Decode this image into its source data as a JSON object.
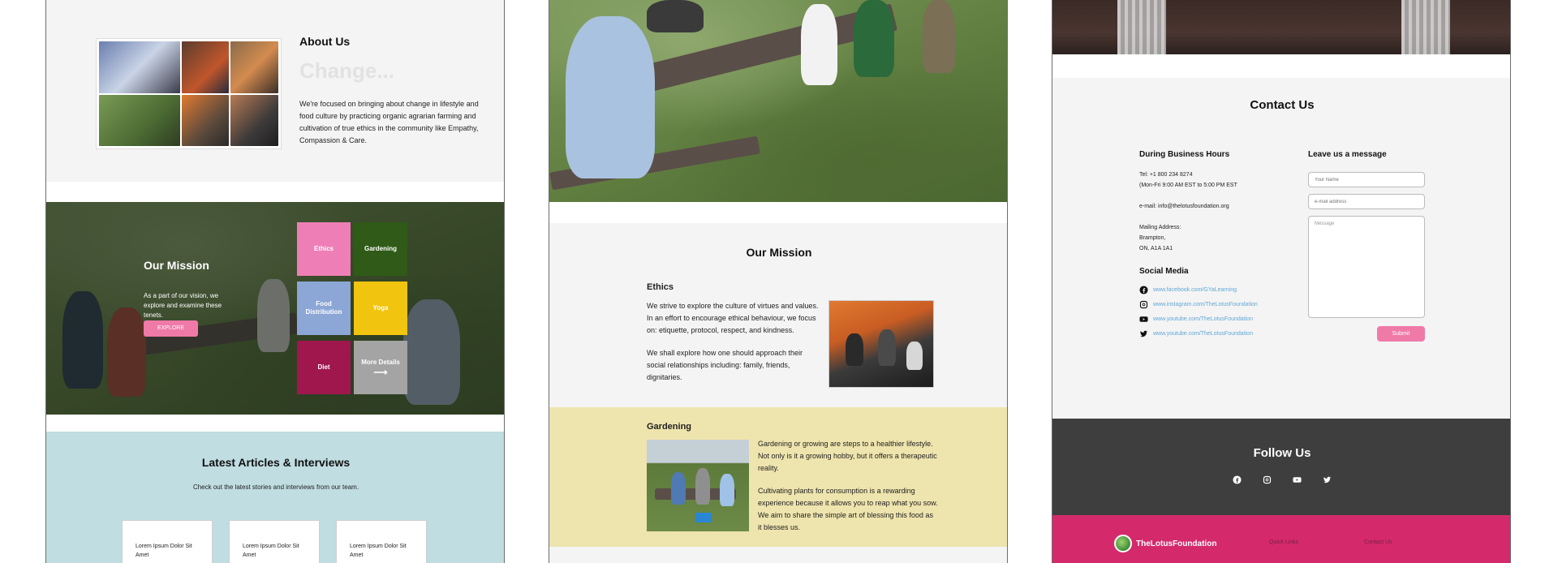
{
  "panel1": {
    "about": {
      "title": "About Us",
      "headline": "Change...",
      "text": "We're focused on bringing about change in lifestyle and food culture by practicing organic agrarian farming and cultivation of true ethics in the community like Empathy, Compassion & Care."
    },
    "mission": {
      "title": "Our Mission",
      "text": "As a part of our vision, we explore and examine these tenets.",
      "button": "EXPLORE",
      "tiles": [
        {
          "label": "Ethics",
          "color": "#ee7fb6"
        },
        {
          "label": "Gardening",
          "color": "#2f5a17"
        },
        {
          "label": "Food Distribution",
          "color": "#8ca6d6"
        },
        {
          "label": "Yoga",
          "color": "#f1c40f"
        },
        {
          "label": "Diet",
          "color": "#a0174d"
        },
        {
          "label": "More Details",
          "color": "#a4a4a4"
        }
      ]
    },
    "articles": {
      "title": "Latest Articles & Interviews",
      "subtitle": "Check out the latest stories and interviews from our team.",
      "cards": [
        "Lorem Ipsum Dolor Sit Amet",
        "Lorem Ipsum Dolor Sit Amet",
        "Lorem Ipsum Dolor Sit Amet"
      ]
    }
  },
  "panel2": {
    "mission_title": "Our Mission",
    "ethics": {
      "heading": "Ethics",
      "p1": "We strive to explore the culture of virtues and values. In an effort to encourage ethical behaviour, we focus on: etiquette, protocol, respect, and kindness.",
      "p2": "We shall explore how one should approach their social relationships including: family, friends, dignitaries."
    },
    "gardening": {
      "heading": "Gardening",
      "p1": "Gardening or growing are steps to a healthier lifestyle. Not only is it a growing hobby, but it offers a therapeutic reality.",
      "p2": "Cultivating plants for consumption is a rewarding experience because it allows you to reap what you sow. We aim to share the simple art of blessing this food as it blesses us."
    }
  },
  "panel3": {
    "contact_title": "Contact Us",
    "hours": {
      "heading": "During Business Hours",
      "tel": "Tel: +1 800 234 8274",
      "time": "(Mon-Fri 9:00 AM EST  to 5:00 PM EST",
      "email": "e-mail: info@thelotusfoundation.org",
      "mail_label": "Mailing Address:",
      "city": "Brampton,",
      "postal": "ON, A1A 1A1"
    },
    "social_heading": "Social Media",
    "social": [
      {
        "icon": "facebook-icon",
        "text": "www.facebook.com/GYaLearning"
      },
      {
        "icon": "instagram-icon",
        "text": "www.instagram.com/TheLotusFoundation"
      },
      {
        "icon": "youtube-icon",
        "text": "www.youtube.com/TheLotusFoundation"
      },
      {
        "icon": "twitter-icon",
        "text": "www.youtube.com/TheLotusFoundation"
      }
    ],
    "form": {
      "heading": "Leave us a message",
      "name_placeholder": "Your Name",
      "email_placeholder": "e-mail address",
      "message_placeholder": "Message",
      "submit": "Submit"
    },
    "follow": {
      "title": "Follow Us"
    },
    "footer": {
      "logo_text": "TheLotusFoundation",
      "quick_links": "Quick Links",
      "contact_us": "Contact Us"
    }
  },
  "colors": {
    "accent_pink": "#ef7aa8",
    "footer_pink": "#d42a6b",
    "dark": "#3e3e3e",
    "link_blue": "#5fa8d6"
  }
}
